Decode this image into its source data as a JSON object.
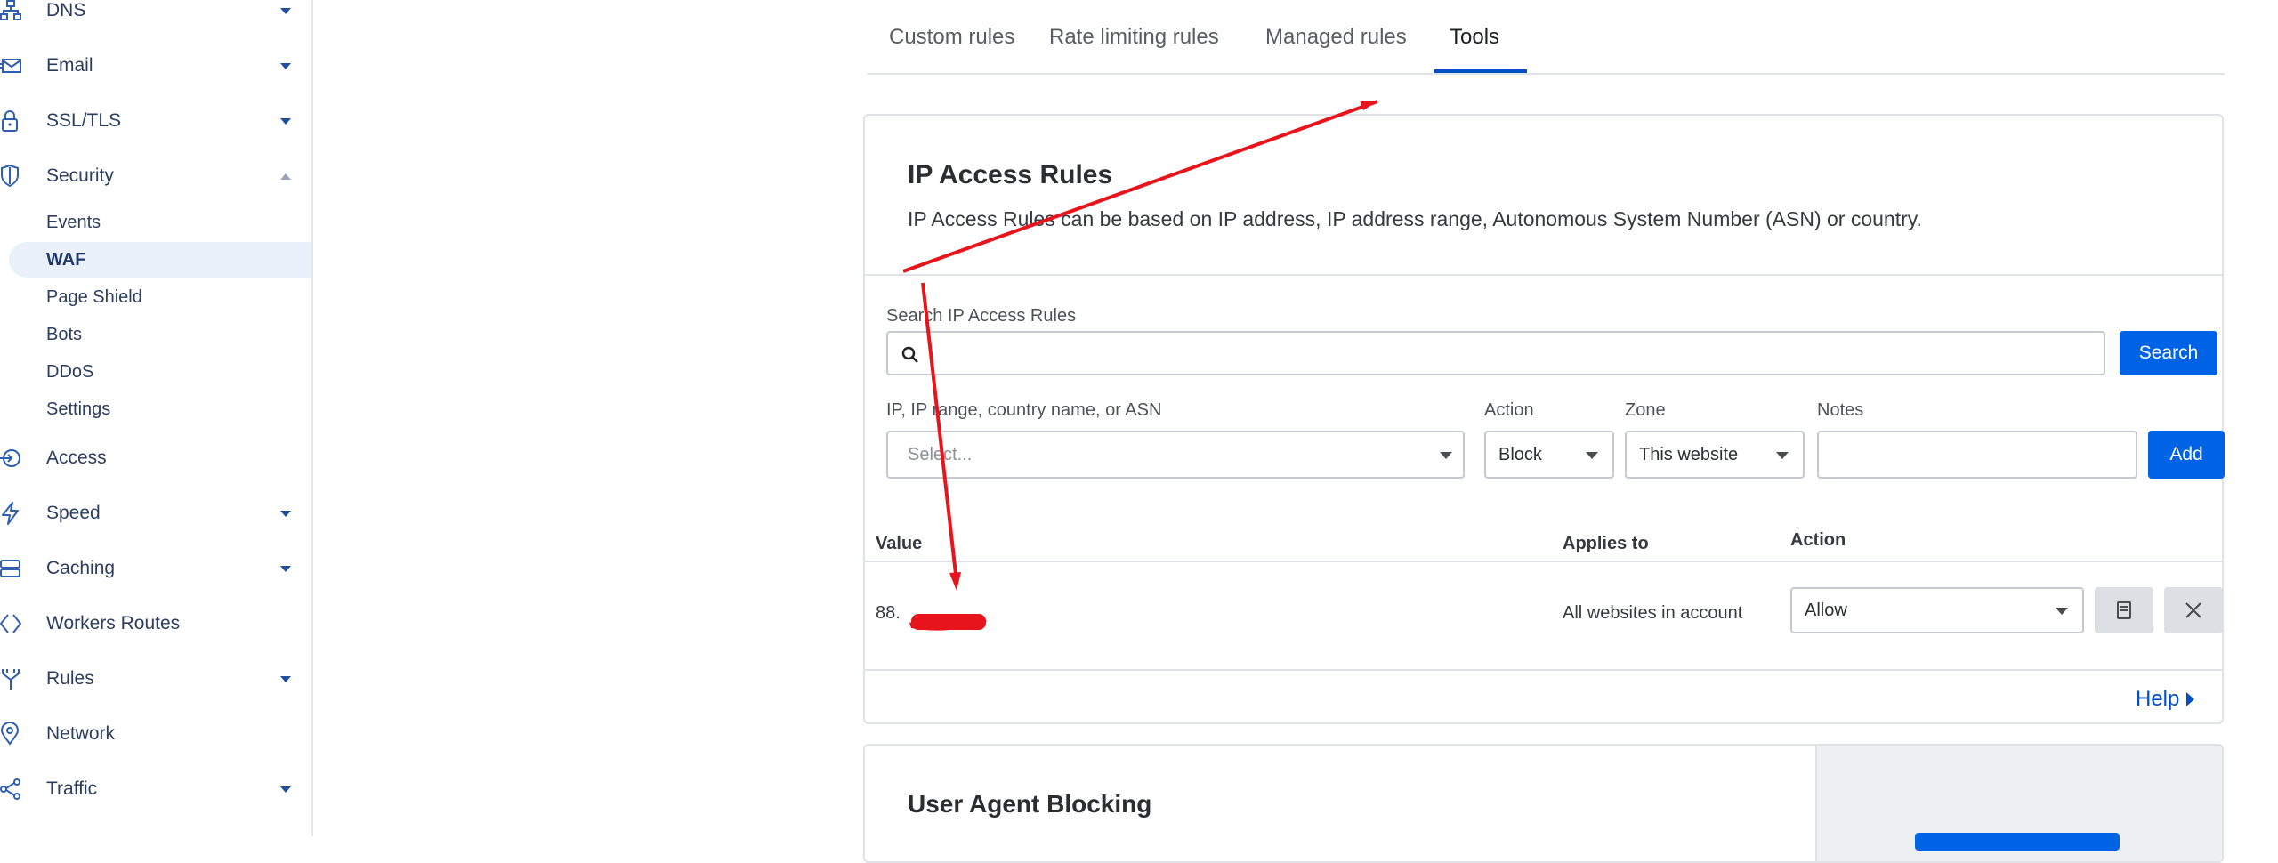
{
  "sidebar": {
    "items": [
      {
        "label": "DNS",
        "icon": "network-icon",
        "caret": "down"
      },
      {
        "label": "Email",
        "icon": "envelope-icon",
        "caret": "down"
      },
      {
        "label": "SSL/TLS",
        "icon": "lock-icon",
        "caret": "down"
      },
      {
        "label": "Security",
        "icon": "shield-icon",
        "caret": "up"
      },
      {
        "label": "Access",
        "icon": "access-icon",
        "caret": null
      },
      {
        "label": "Speed",
        "icon": "lightning-icon",
        "caret": "down"
      },
      {
        "label": "Caching",
        "icon": "server-icon",
        "caret": "down"
      },
      {
        "label": "Workers Routes",
        "icon": "workers-icon",
        "caret": null
      },
      {
        "label": "Rules",
        "icon": "rules-icon",
        "caret": "down"
      },
      {
        "label": "Network",
        "icon": "location-pin-icon",
        "caret": null
      },
      {
        "label": "Traffic",
        "icon": "traffic-icon",
        "caret": "down"
      }
    ],
    "security_subitems": [
      {
        "label": "Events",
        "active": false
      },
      {
        "label": "WAF",
        "active": true
      },
      {
        "label": "Page Shield",
        "active": false
      },
      {
        "label": "Bots",
        "active": false
      },
      {
        "label": "DDoS",
        "active": false
      },
      {
        "label": "Settings",
        "active": false
      }
    ]
  },
  "tabs": [
    {
      "label": "Custom rules",
      "active": false
    },
    {
      "label": "Rate limiting rules",
      "active": false
    },
    {
      "label": "Managed rules",
      "active": false
    },
    {
      "label": "Tools",
      "active": true
    }
  ],
  "ip_access_rules": {
    "title": "IP Access Rules",
    "description": "IP Access Rules can be based on IP address, IP address range, Autonomous System Number (ASN) or country.",
    "search": {
      "label": "Search IP Access Rules",
      "value": "",
      "button": "Search"
    },
    "form": {
      "value_label": "IP, IP range, country name, or ASN",
      "value_placeholder": "Select...",
      "action_label": "Action",
      "action_value": "Block",
      "zone_label": "Zone",
      "zone_value": "This website",
      "notes_label": "Notes",
      "notes_value": "",
      "add_button": "Add"
    },
    "table": {
      "headers": {
        "value": "Value",
        "applies_to": "Applies to",
        "action": "Action"
      },
      "rows": [
        {
          "value": "88.",
          "applies_to": "All websites in account",
          "action": "Allow"
        }
      ]
    },
    "help_link": "Help"
  },
  "user_agent_blocking": {
    "title": "User Agent Blocking"
  },
  "colors": {
    "accent": "#0063e6",
    "annotation": "#e8141c",
    "sidebar_text": "#2c3e5d"
  }
}
